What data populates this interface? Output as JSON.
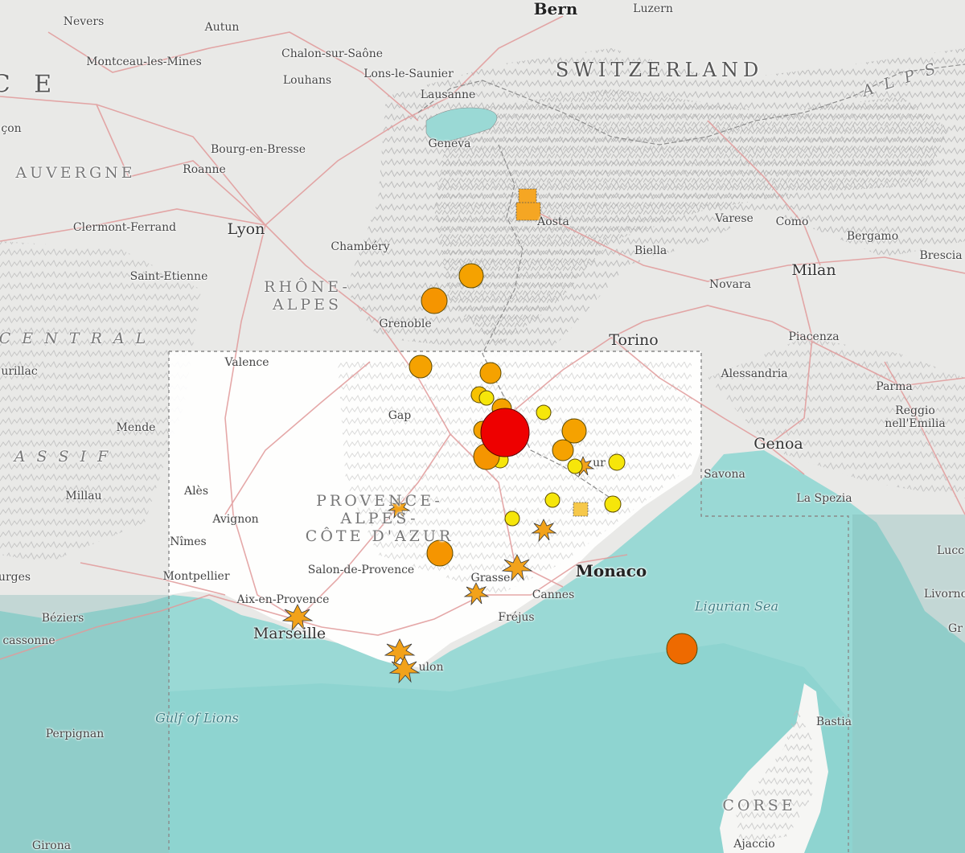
{
  "map": {
    "colors": {
      "land": "#e9e9e7",
      "highlight_land": "#ffffff",
      "sea": "#9ad9d5",
      "sea_deep": "#8dd2cf",
      "roads": "#e19a9a",
      "borders": "#9b9b9b",
      "relief": "#bdbdbd"
    },
    "labels": {
      "countries": [
        {
          "id": "switzerland",
          "text": "SWITZERLAND"
        },
        {
          "id": "france-fragment",
          "text": "C E"
        },
        {
          "id": "alps-fragment",
          "text": "A L P S"
        }
      ],
      "regions": [
        {
          "id": "auvergne",
          "text": "AUVERGNE"
        },
        {
          "id": "rhone-alpes",
          "text": "RHÔNE-\nALPES"
        },
        {
          "id": "centrale",
          "text": "C E N T R A L"
        },
        {
          "id": "massif",
          "text": "A S S I F"
        },
        {
          "id": "paca",
          "text": "PROVENCE-\nALPES-\nCÔTE D'AZUR"
        },
        {
          "id": "corse",
          "text": "CORSE"
        }
      ],
      "water": [
        {
          "id": "ligurian-sea",
          "text": "Ligurian Sea"
        },
        {
          "id": "gulf-of-lions",
          "text": "Gulf of Lions"
        }
      ],
      "cities": [
        {
          "id": "bern",
          "text": "Bern"
        },
        {
          "id": "luzern",
          "text": "Luzern"
        },
        {
          "id": "nevers",
          "text": "Nevers"
        },
        {
          "id": "autun",
          "text": "Autun"
        },
        {
          "id": "montceau",
          "text": "Montceau-les-Mines"
        },
        {
          "id": "chalon",
          "text": "Chalon-sur-Saône"
        },
        {
          "id": "louhans",
          "text": "Louhans"
        },
        {
          "id": "lons",
          "text": "Lons-le-Saunier"
        },
        {
          "id": "lausanne",
          "text": "Lausanne"
        },
        {
          "id": "geneva",
          "text": "Geneva"
        },
        {
          "id": "bourg",
          "text": "Bourg-en-Bresse"
        },
        {
          "id": "roanne",
          "text": "Roanne"
        },
        {
          "id": "lyon",
          "text": "Lyon"
        },
        {
          "id": "clermont",
          "text": "Clermont-Ferrand"
        },
        {
          "id": "chambery",
          "text": "Chambéry"
        },
        {
          "id": "aosta",
          "text": "Aosta"
        },
        {
          "id": "varese",
          "text": "Varese"
        },
        {
          "id": "como",
          "text": "Como"
        },
        {
          "id": "bergamo",
          "text": "Bergamo"
        },
        {
          "id": "brescia",
          "text": "Brescia"
        },
        {
          "id": "biella",
          "text": "Biella"
        },
        {
          "id": "milan",
          "text": "Milan"
        },
        {
          "id": "novara",
          "text": "Novara"
        },
        {
          "id": "saint-etienne",
          "text": "Saint-Etienne"
        },
        {
          "id": "grenoble",
          "text": "Grenoble"
        },
        {
          "id": "torino",
          "text": "Torino"
        },
        {
          "id": "piacenza",
          "text": "Piacenza"
        },
        {
          "id": "aurillac",
          "text": "urillac"
        },
        {
          "id": "valence",
          "text": "Valence"
        },
        {
          "id": "alessandria",
          "text": "Alessandria"
        },
        {
          "id": "parma",
          "text": "Parma"
        },
        {
          "id": "reggio",
          "text": "Reggio\nnell'Emilia"
        },
        {
          "id": "mende",
          "text": "Mende"
        },
        {
          "id": "gap",
          "text": "Gap"
        },
        {
          "id": "genoa",
          "text": "Genoa"
        },
        {
          "id": "millau",
          "text": "Millau"
        },
        {
          "id": "savona",
          "text": "Savona"
        },
        {
          "id": "ales",
          "text": "Alès"
        },
        {
          "id": "la-spezia",
          "text": "La Spezia"
        },
        {
          "id": "avignon",
          "text": "Avignon"
        },
        {
          "id": "nimes",
          "text": "Nîmes"
        },
        {
          "id": "lucca",
          "text": "Lucc"
        },
        {
          "id": "montpellier",
          "text": "Montpellier"
        },
        {
          "id": "salon",
          "text": "Salon-de-Provence"
        },
        {
          "id": "grasse",
          "text": "Grasse"
        },
        {
          "id": "monaco",
          "text": "Monaco"
        },
        {
          "id": "livorno",
          "text": "Livorno"
        },
        {
          "id": "cannes",
          "text": "Cannes"
        },
        {
          "id": "aix",
          "text": "Aix-en-Provence"
        },
        {
          "id": "frejus",
          "text": "Fréjus"
        },
        {
          "id": "beziers",
          "text": "Béziers"
        },
        {
          "id": "marseille",
          "text": "Marseille"
        },
        {
          "id": "carcassonne",
          "text": "cassonne"
        },
        {
          "id": "toulon",
          "text": "ulon"
        },
        {
          "id": "bastia",
          "text": "Bastia"
        },
        {
          "id": "perpignan",
          "text": "Perpignan"
        },
        {
          "id": "ajaccio",
          "text": "Ajaccio"
        },
        {
          "id": "girona",
          "text": "Girona"
        },
        {
          "id": "nice-fragment",
          "text": "ur"
        },
        {
          "id": "con-fragment",
          "text": "çon"
        },
        {
          "id": "urges-fragment",
          "text": "urges"
        },
        {
          "id": "gr-fragment",
          "text": "Gr"
        }
      ]
    },
    "events": {
      "legend_note": "",
      "largest_event_color": "#ee0000",
      "orange_dark": "#ee7a00",
      "orange": "#f5a000",
      "yellow": "#f6e60a"
    }
  }
}
